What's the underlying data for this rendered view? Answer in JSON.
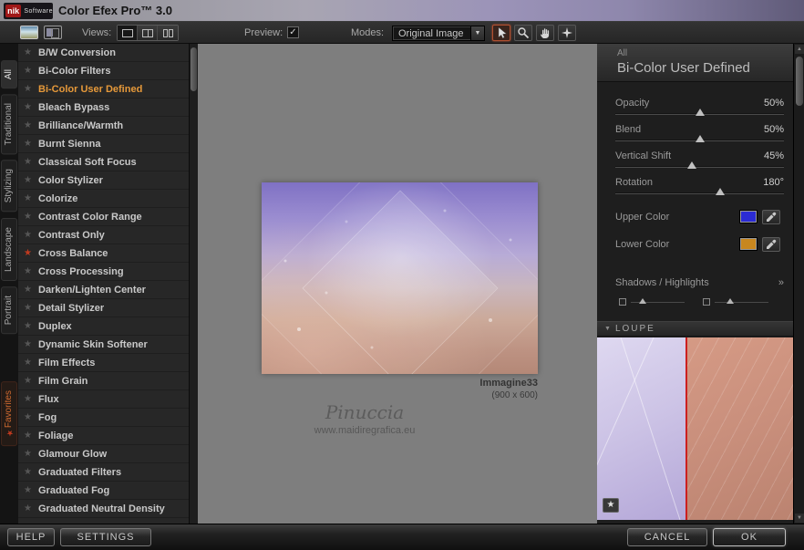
{
  "titlebar": {
    "logo_nik": "nik",
    "logo_software": "Software",
    "title": "Color Efex Pro™ 3.0"
  },
  "toolbar": {
    "views_label": "Views:",
    "preview_label": "Preview:",
    "modes_label": "Modes:",
    "mode_value": "Original Image"
  },
  "icons": {
    "check": "✓",
    "down_arrow": "▼",
    "star": "★",
    "expand": "»",
    "section_triangle": "▼"
  },
  "tabs": [
    {
      "label": "All",
      "active": true
    },
    {
      "label": "Traditional"
    },
    {
      "label": "Stylizing"
    },
    {
      "label": "Landscape"
    },
    {
      "label": "Portrait"
    },
    {
      "label": "Favorites",
      "favorite": true
    }
  ],
  "filter_list": [
    {
      "label": "B/W Conversion"
    },
    {
      "label": "Bi-Color Filters"
    },
    {
      "label": "Bi-Color User Defined",
      "selected": true
    },
    {
      "label": "Bleach Bypass"
    },
    {
      "label": "Brilliance/Warmth"
    },
    {
      "label": "Burnt Sienna"
    },
    {
      "label": "Classical Soft Focus"
    },
    {
      "label": "Color Stylizer"
    },
    {
      "label": "Colorize"
    },
    {
      "label": "Contrast Color Range"
    },
    {
      "label": "Contrast Only"
    },
    {
      "label": "Cross Balance",
      "favorite": true
    },
    {
      "label": "Cross Processing"
    },
    {
      "label": "Darken/Lighten Center"
    },
    {
      "label": "Detail Stylizer"
    },
    {
      "label": "Duplex"
    },
    {
      "label": "Dynamic Skin Softener"
    },
    {
      "label": "Film Effects"
    },
    {
      "label": "Film Grain"
    },
    {
      "label": "Flux"
    },
    {
      "label": "Fog"
    },
    {
      "label": "Foliage"
    },
    {
      "label": "Glamour Glow"
    },
    {
      "label": "Graduated Filters"
    },
    {
      "label": "Graduated Fog"
    },
    {
      "label": "Graduated Neutral Density"
    }
  ],
  "canvas": {
    "image_name": "Immagine33",
    "image_size": "(900 x 600)",
    "watermark_name": "Pinuccia",
    "watermark_site": "www.maidiregrafica.eu"
  },
  "panel": {
    "category": "All",
    "title": "Bi-Color User Defined",
    "sliders": [
      {
        "label": "Opacity",
        "value": "50%",
        "pos": 0.5
      },
      {
        "label": "Blend",
        "value": "50%",
        "pos": 0.5
      },
      {
        "label": "Vertical Shift",
        "value": "45%",
        "pos": 0.45
      },
      {
        "label": "Rotation",
        "value": "180°",
        "pos": 0.63
      }
    ],
    "upper_color": {
      "label": "Upper Color",
      "color": "#2b2bd4"
    },
    "lower_color": {
      "label": "Lower Color",
      "color": "#c8871f"
    },
    "shadows_highlights_label": "Shadows / Highlights",
    "loupe_label": "LOUPE"
  },
  "footer": {
    "help": "HELP",
    "settings": "SETTINGS",
    "cancel": "CANCEL",
    "ok": "OK"
  },
  "colors": {
    "accent": "#e6993a",
    "favorite_star": "#c03a1f",
    "canvas_bg": "#7e7e7e"
  }
}
